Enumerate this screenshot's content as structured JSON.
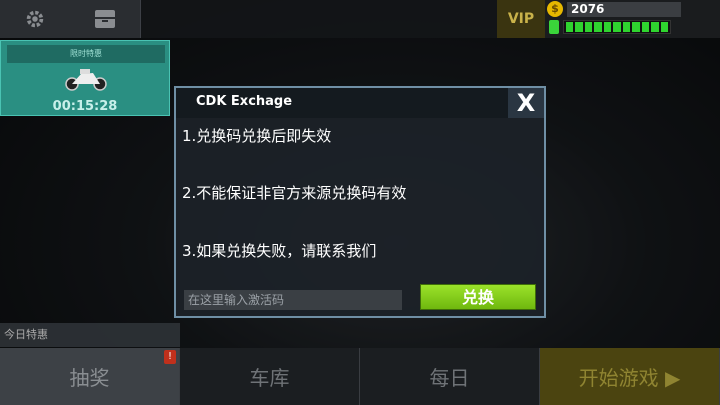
{
  "topbar": {
    "settings_icon": "gear-icon",
    "garage_icon": "box-icon",
    "vip_label": "VIP",
    "coin_symbol": "$",
    "coins": "2076",
    "fuel_segments": 11
  },
  "event_card": {
    "title": "限时特惠",
    "timer": "00:15:28"
  },
  "today_special": "今日特惠",
  "modal": {
    "title": "CDK Exchage",
    "close_label": "X",
    "rules": [
      "1.兑换码兑换后即失效",
      "2.不能保证非官方来源兑换码有效",
      "3.如果兑换失败，请联系我们"
    ],
    "input_placeholder": "在这里输入激活码",
    "redeem_label": "兑换"
  },
  "bottom_nav": {
    "lottery": "抽奖",
    "garage": "车库",
    "daily": "每日",
    "start": "开始游戏 ▶",
    "badge": "!"
  }
}
